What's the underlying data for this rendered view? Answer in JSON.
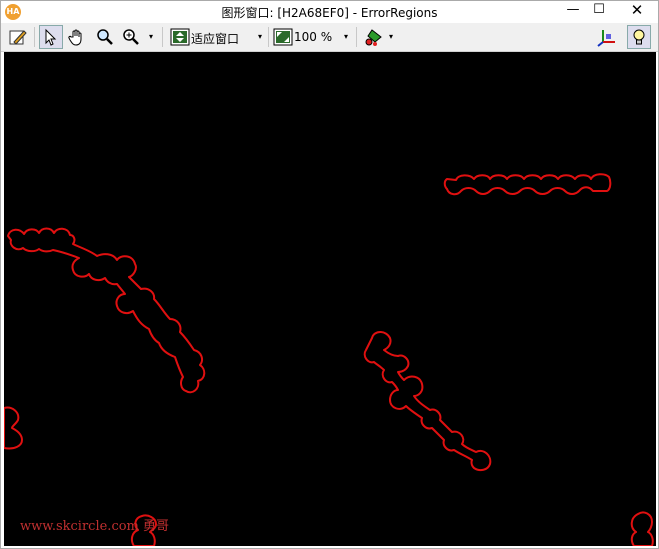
{
  "app": {
    "logo_text": "HA"
  },
  "window": {
    "title": "图形窗口: [H2A68EF0] - ErrorRegions",
    "min_label": "—",
    "max_label": "☐",
    "close_label": "✕"
  },
  "toolbar": {
    "zoom_mode_label": "适应窗口",
    "zoom_percent": "100 %",
    "arrow": "▾"
  },
  "canvas": {
    "background": "#000000",
    "region_color": "#e01010",
    "watermark": "www.skcircle.com 勇哥"
  }
}
